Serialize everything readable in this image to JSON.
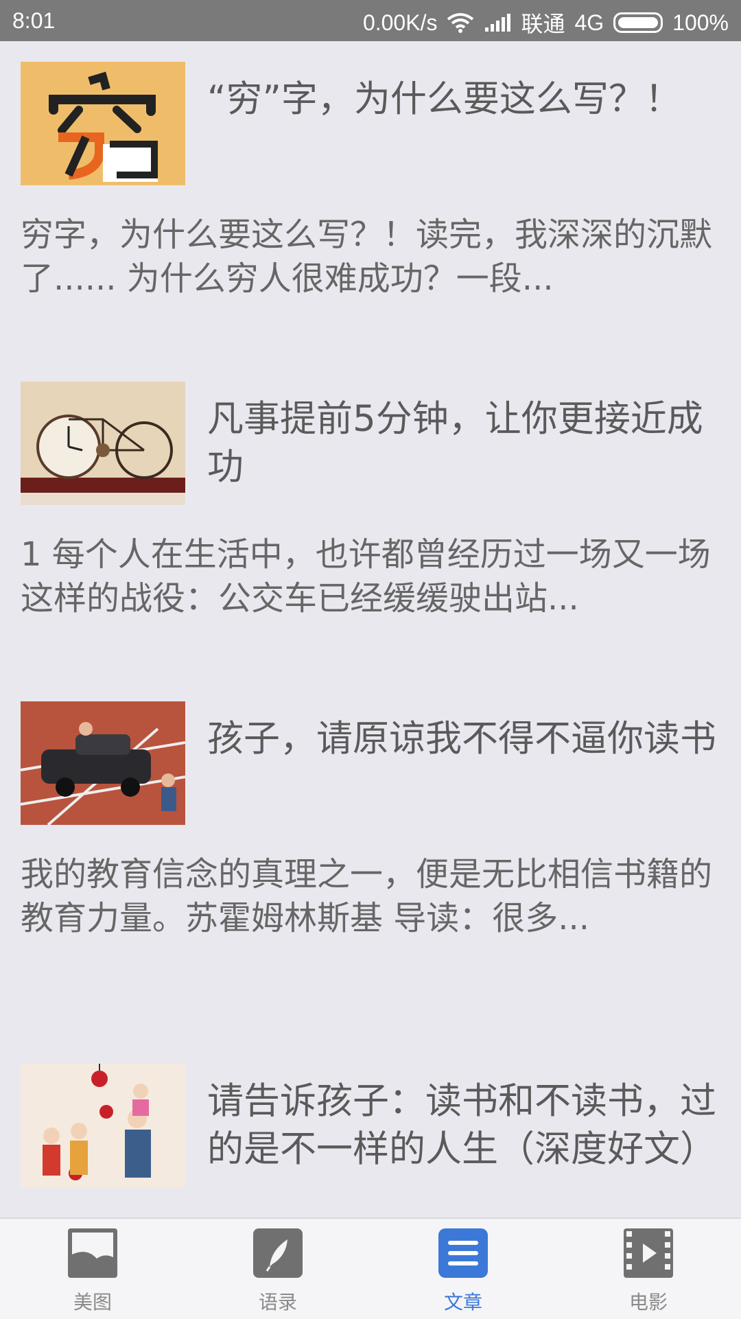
{
  "status_bar": {
    "time": "8:01",
    "speed": "0.00K/s",
    "carrier": "联通",
    "network": "4G",
    "battery": "100%"
  },
  "articles": [
    {
      "title": "“穷”字，为什么要这么写？！",
      "summary": " 穷字，为什么要这么写？！读完，我深深的沉默了...... 为什么穷人很难成功？一段..."
    },
    {
      "title": "凡事提前5分钟，让你更接近成功",
      "summary": " 1 每个人在生活中，也许都曾经历过一场又一场这样的战役：公交车已经缓缓驶出站..."
    },
    {
      "title": "孩子，请原谅我不得不逼你读书",
      "summary": " 我的教育信念的真理之一，便是无比相信书籍的教育力量。苏霍姆林斯基 导读：很多..."
    },
    {
      "title": "请告诉孩子：读书和不读书，过的是不一样的人生（深度好文）",
      "summary": ""
    }
  ],
  "nav": {
    "tabs": [
      {
        "label": "美图",
        "icon": "image-icon"
      },
      {
        "label": "语录",
        "icon": "feather-icon"
      },
      {
        "label": "文章",
        "icon": "article-icon"
      },
      {
        "label": "电影",
        "icon": "film-icon"
      }
    ],
    "active_index": 2,
    "active_color": "#3C78D8",
    "inactive_color": "#707070"
  }
}
